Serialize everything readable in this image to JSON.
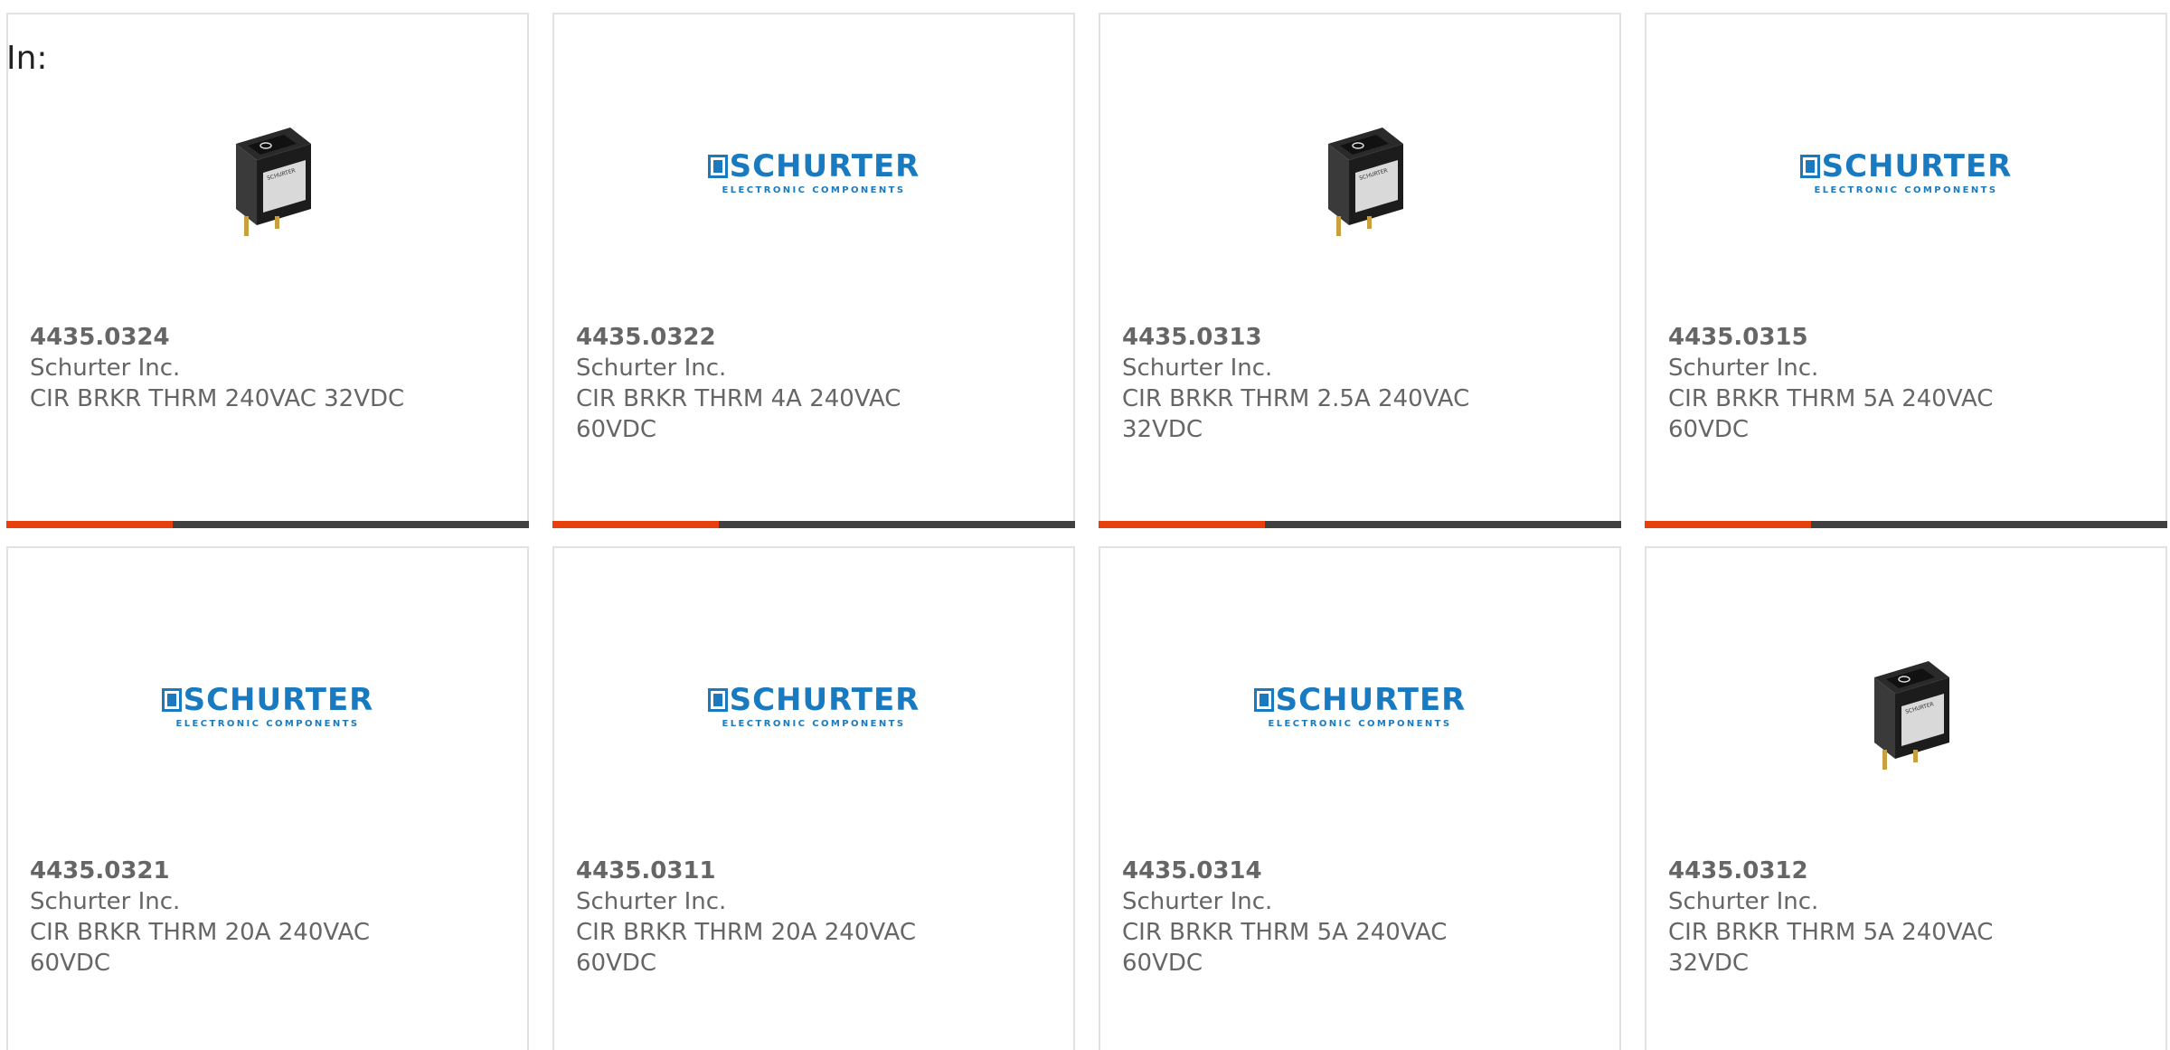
{
  "filter": {
    "label": "In:"
  },
  "colors": {
    "accent_red": "#e8400c",
    "accent_dark": "#404040",
    "brand_blue": "#1a7abf",
    "text": "#666666"
  },
  "products": [
    {
      "part": "4435.0324",
      "manufacturer": "Schurter Inc.",
      "description": "CIR BRKR THRM 240VAC 32VDC",
      "image": "rocker-switch-photo"
    },
    {
      "part": "4435.0322",
      "manufacturer": "Schurter Inc.",
      "description": "CIR BRKR THRM 4A 240VAC 60VDC",
      "image": "schurter-logo"
    },
    {
      "part": "4435.0313",
      "manufacturer": "Schurter Inc.",
      "description": "CIR BRKR THRM 2.5A 240VAC 32VDC",
      "image": "rocker-switch-photo"
    },
    {
      "part": "4435.0315",
      "manufacturer": "Schurter Inc.",
      "description": "CIR BRKR THRM 5A 240VAC 60VDC",
      "image": "schurter-logo"
    },
    {
      "part": "4435.0321",
      "manufacturer": "Schurter Inc.",
      "description": "CIR BRKR THRM 20A 240VAC 60VDC",
      "image": "schurter-logo"
    },
    {
      "part": "4435.0311",
      "manufacturer": "Schurter Inc.",
      "description": "CIR BRKR THRM 20A 240VAC 60VDC",
      "image": "schurter-logo"
    },
    {
      "part": "4435.0314",
      "manufacturer": "Schurter Inc.",
      "description": "CIR BRKR THRM 5A 240VAC 60VDC",
      "image": "schurter-logo"
    },
    {
      "part": "4435.0312",
      "manufacturer": "Schurter Inc.",
      "description": "CIR BRKR THRM 5A 240VAC 32VDC",
      "image": "rocker-switch-photo"
    }
  ],
  "logo": {
    "name": "SCHURTER",
    "tagline": "ELECTRONIC COMPONENTS"
  }
}
